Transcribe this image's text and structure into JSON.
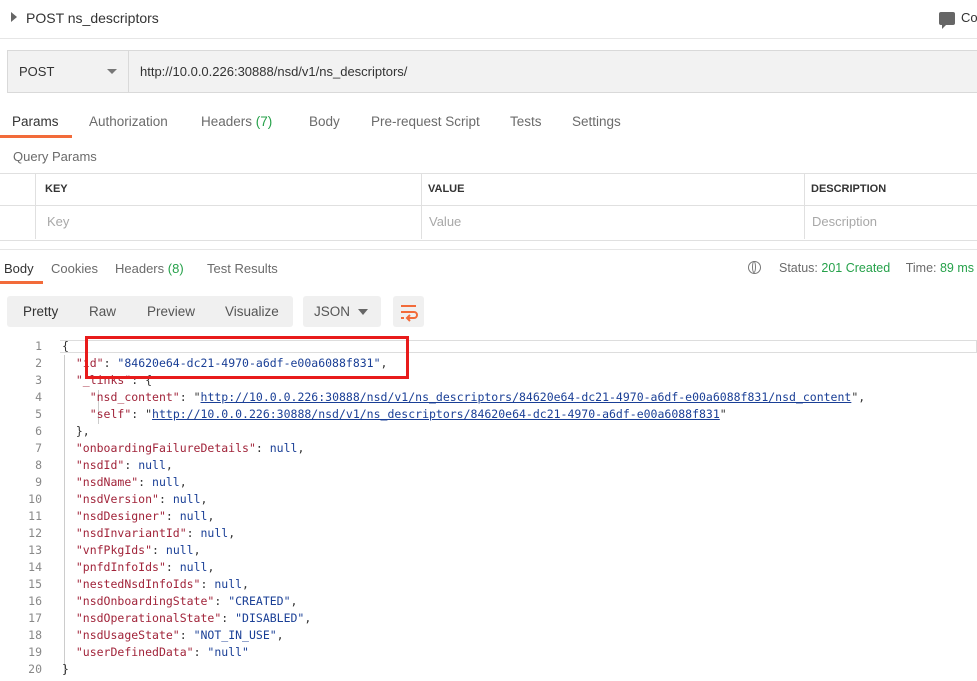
{
  "request": {
    "title": "POST ns_descriptors",
    "comments_label": "Co",
    "method": "POST",
    "url": "http://10.0.0.226:30888/nsd/v1/ns_descriptors/"
  },
  "request_tabs": [
    {
      "label": "Params",
      "active": true
    },
    {
      "label": "Authorization"
    },
    {
      "label": "Headers",
      "count": "(7)"
    },
    {
      "label": "Body"
    },
    {
      "label": "Pre-request Script"
    },
    {
      "label": "Tests"
    },
    {
      "label": "Settings"
    }
  ],
  "query_params": {
    "title": "Query Params",
    "columns": [
      "KEY",
      "VALUE",
      "DESCRIPTION"
    ],
    "placeholders": [
      "Key",
      "Value",
      "Description"
    ]
  },
  "response_tabs": [
    {
      "label": "Body",
      "active": true
    },
    {
      "label": "Cookies"
    },
    {
      "label": "Headers",
      "count": "(8)"
    },
    {
      "label": "Test Results"
    }
  ],
  "response_status": {
    "status_label": "Status:",
    "status_value": "201 Created",
    "time_label": "Time:",
    "time_value": "89 ms"
  },
  "view_modes": [
    "Pretty",
    "Raw",
    "Preview",
    "Visualize"
  ],
  "format": "JSON",
  "icons": {
    "caret": "caret-right-icon",
    "comments": "comment-icon",
    "method_dropdown": "chevron-down-icon",
    "globe": "globe-icon",
    "wrap": "wrap-lines-icon"
  },
  "colors": {
    "accent": "#f26b3a",
    "status_ok": "#26a14a",
    "highlight": "#e81b1b"
  },
  "json_lines": [
    {
      "n": "1",
      "t": "{"
    },
    {
      "n": "2",
      "key": "\"id\"",
      "val": "\"84620e64-dc21-4970-a6df-e00a6088f831\"",
      "tail": ","
    },
    {
      "n": "3",
      "key": "\"_links\"",
      "raw": ": {"
    },
    {
      "n": "4",
      "indent": 2,
      "key": "\"nsd_content\"",
      "link": "http://10.0.0.226:30888/nsd/v1/ns_descriptors/84620e64-dc21-4970-a6df-e00a6088f831/nsd_content",
      "tail": ","
    },
    {
      "n": "5",
      "indent": 2,
      "key": "\"self\"",
      "link": "http://10.0.0.226:30888/nsd/v1/ns_descriptors/84620e64-dc21-4970-a6df-e00a6088f831"
    },
    {
      "n": "6",
      "t": "},"
    },
    {
      "n": "7",
      "key": "\"onboardingFailureDetails\"",
      "nullv": "null",
      "tail": ","
    },
    {
      "n": "8",
      "key": "\"nsdId\"",
      "nullv": "null",
      "tail": ","
    },
    {
      "n": "9",
      "key": "\"nsdName\"",
      "nullv": "null",
      "tail": ","
    },
    {
      "n": "10",
      "key": "\"nsdVersion\"",
      "nullv": "null",
      "tail": ","
    },
    {
      "n": "11",
      "key": "\"nsdDesigner\"",
      "nullv": "null",
      "tail": ","
    },
    {
      "n": "12",
      "key": "\"nsdInvariantId\"",
      "nullv": "null",
      "tail": ","
    },
    {
      "n": "13",
      "key": "\"vnfPkgIds\"",
      "nullv": "null",
      "tail": ","
    },
    {
      "n": "14",
      "key": "\"pnfdInfoIds\"",
      "nullv": "null",
      "tail": ","
    },
    {
      "n": "15",
      "key": "\"nestedNsdInfoIds\"",
      "nullv": "null",
      "tail": ","
    },
    {
      "n": "16",
      "key": "\"nsdOnboardingState\"",
      "val": "\"CREATED\"",
      "tail": ","
    },
    {
      "n": "17",
      "key": "\"nsdOperationalState\"",
      "val": "\"DISABLED\"",
      "tail": ","
    },
    {
      "n": "18",
      "key": "\"nsdUsageState\"",
      "val": "\"NOT_IN_USE\"",
      "tail": ","
    },
    {
      "n": "19",
      "key": "\"userDefinedData\"",
      "val": "\"null\""
    },
    {
      "n": "20",
      "t": "}"
    }
  ]
}
